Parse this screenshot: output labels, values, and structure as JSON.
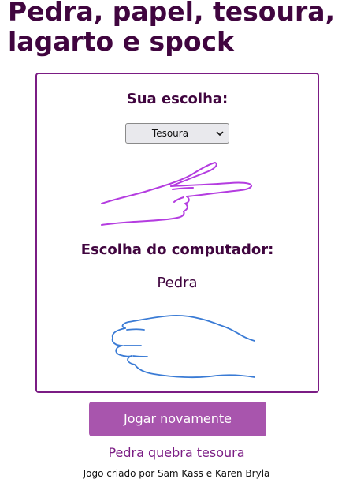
{
  "page": {
    "title": "Pedra, papel, tesoura, lagarto e spock"
  },
  "player": {
    "heading": "Sua escolha:",
    "selected_option": "Tesoura",
    "hand_icon": "scissors-hand-icon",
    "hand_color": "#b43ce0"
  },
  "computer": {
    "heading": "Escolha do computador:",
    "choice": "Pedra",
    "hand_icon": "rock-hand-icon",
    "hand_color": "#3a7bd5"
  },
  "actions": {
    "play_again_label": "Jogar novamente"
  },
  "result": {
    "text": "Pedra quebra tesoura"
  },
  "footer": {
    "credit": "Jogo criado por Sam Kass e Karen Bryla"
  },
  "colors": {
    "title": "#40053f",
    "card_border": "#7b1c84",
    "button_bg": "#a855ad",
    "result_text": "#7b1c84"
  }
}
